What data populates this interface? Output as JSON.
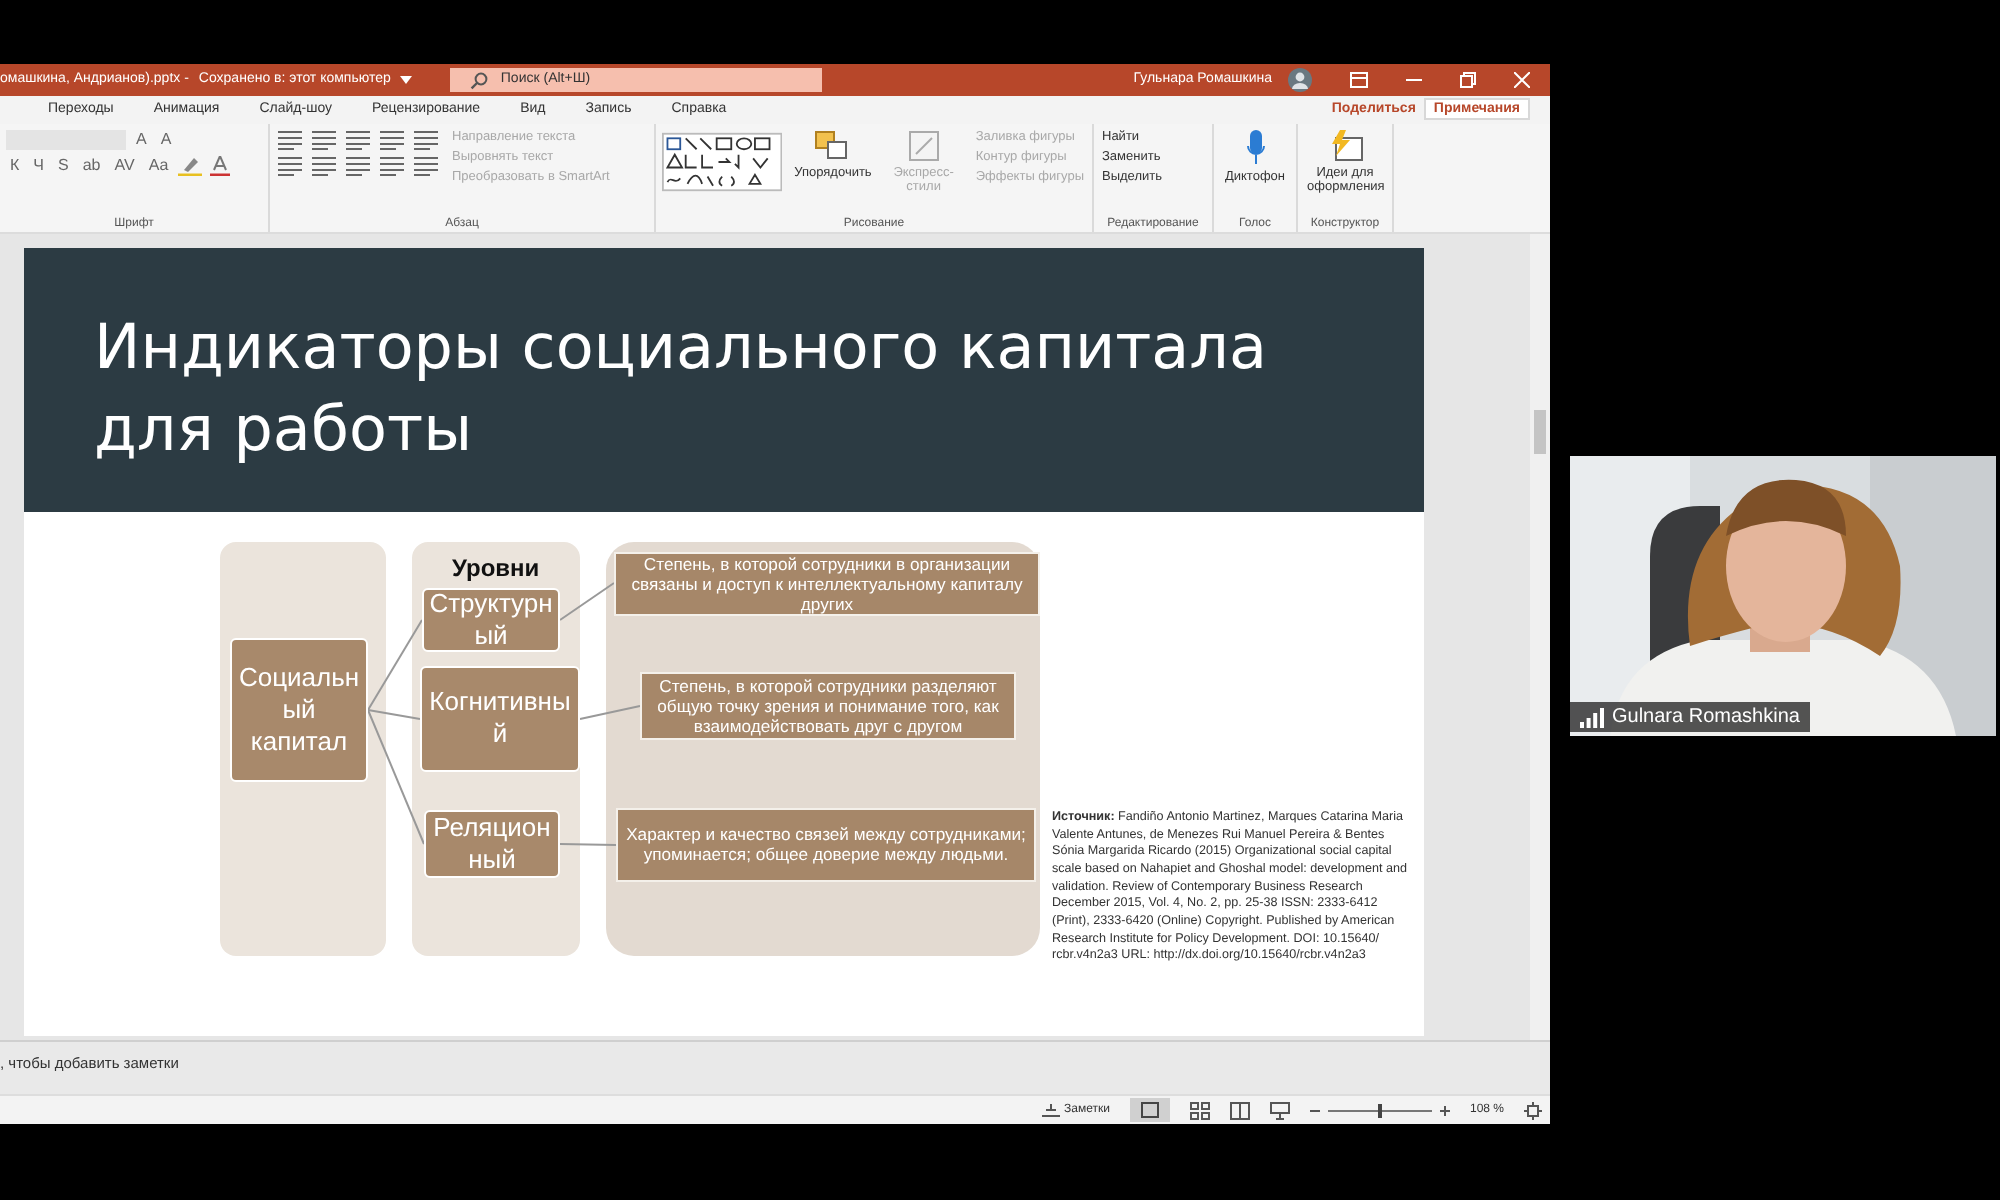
{
  "window": {
    "title": "омашкина, Андрианов).pptx -",
    "save_status": "Сохранено в: этот компьютер",
    "search_placeholder": "Поиск (Alt+Ш)",
    "user": "Гульнара Ромашкина"
  },
  "tabs": [
    {
      "label": "Переходы",
      "selected": false
    },
    {
      "label": "Анимация",
      "selected": false
    },
    {
      "label": "Слайд-шоу",
      "selected": false
    },
    {
      "label": "Рецензирование",
      "selected": false
    },
    {
      "label": "Вид",
      "selected": false
    },
    {
      "label": "Запись",
      "selected": false
    },
    {
      "label": "Справка",
      "selected": false
    }
  ],
  "share_button": "Поделиться",
  "comments_button": "Примечания",
  "ribbon": {
    "font": {
      "label": "Шрифт",
      "size_buttons": [
        "A",
        "A"
      ],
      "format_buttons": [
        "К",
        "Ч",
        "S",
        "аb",
        "AV",
        "Аа"
      ]
    },
    "paragraph": {
      "label": "Абзац",
      "commands": [
        {
          "label": "Направление текста",
          "disabled": true
        },
        {
          "label": "Выровнять текст",
          "disabled": true
        },
        {
          "label": "Преобразовать в SmartArt",
          "disabled": true
        }
      ]
    },
    "drawing": {
      "label": "Рисование",
      "arrange": {
        "label": "Упорядочить",
        "disabled": false
      },
      "quick_styles": {
        "label": "Экспресс-стили",
        "disabled": true
      },
      "commands": [
        {
          "label": "Заливка фигуры",
          "disabled": true
        },
        {
          "label": "Контур фигуры",
          "disabled": true
        },
        {
          "label": "Эффекты фигуры",
          "disabled": true
        }
      ]
    },
    "editing": {
      "label": "Редактирование",
      "commands": [
        {
          "label": "Найти",
          "disabled": false
        },
        {
          "label": "Заменить",
          "disabled": false
        },
        {
          "label": "Выделить",
          "disabled": false
        }
      ]
    },
    "voice": {
      "label": "Голос",
      "button": "Диктофон"
    },
    "designer": {
      "label": "Конструктор",
      "button": "Идеи для оформления"
    }
  },
  "slide": {
    "title": "Индикаторы социального капитала для работы",
    "diagram": {
      "header": "Уровни",
      "root": "Социальный капитал",
      "levels": [
        {
          "name": "Структурный",
          "description": "Степень, в которой сотрудники в организации связаны и доступ к интеллектуальному капиталу других"
        },
        {
          "name": "Когнитивный",
          "description": "Степень, в которой сотрудники разделяют общую точку зрения и понимание того, как взаимодействовать друг с другом"
        },
        {
          "name": "Реляционный",
          "description": "Характер и качество связей между сотрудниками; упоминается; общее доверие между людьми."
        }
      ]
    },
    "source": "**Источник:** Fandiño Antonio Martinez, Marques Catarina Maria Valente Antunes, de Menezes Rui Manuel Pereira & Bentes Sónia Margarida Ricardo (2015) Organizational social capital scale based on Nahapiet and Ghoshal model: development and validation. Review of Contemporary Business Research December 2015, Vol. 4, No. 2, pp. 25-38 ISSN: 2333-6412 (Print), 2333-6420 (Online) Copyright. Published by American Research Institute for Policy Development. DOI: 10.15640/ rcbr.v4n2a3 URL: http://dx.doi.org/10.15640/rcbr.v4n2a3"
  },
  "notes_hint": ", чтобы добавить заметки",
  "status_bar": {
    "notes_button": "Заметки",
    "zoom": "108 %",
    "zoom_slider": {
      "level": 0.5
    }
  },
  "video": {
    "name": "Gulnara Romashkina"
  }
}
